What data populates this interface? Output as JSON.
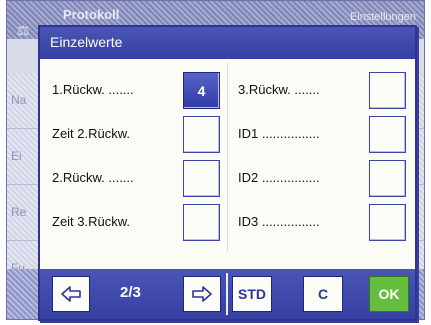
{
  "background": {
    "title": "Protokoll",
    "title_right": "Einstellungen",
    "rows": [
      "Na",
      "Ei",
      "Re",
      "Fu"
    ]
  },
  "dialog": {
    "title": "Einzelwerte",
    "left": [
      {
        "label": "1.Rückw.  .......",
        "value": "4",
        "active": true
      },
      {
        "label": "Zeit 2.Rückw.",
        "value": "",
        "active": false
      },
      {
        "label": "2.Rückw.  .......",
        "value": "",
        "active": false
      },
      {
        "label": "Zeit 3.Rückw.",
        "value": "",
        "active": false
      }
    ],
    "right": [
      {
        "label": "3.Rückw.  .......",
        "value": "",
        "active": false
      },
      {
        "label": "ID1  ................",
        "value": "",
        "active": false
      },
      {
        "label": "ID2  ................",
        "value": "",
        "active": false
      },
      {
        "label": "ID3  ................",
        "value": "",
        "active": false
      }
    ]
  },
  "nav": {
    "page": "2/3",
    "prev_icon": "arrow-left-icon",
    "next_icon": "arrow-right-icon",
    "std_label": "STD",
    "c_label": "C",
    "ok_label": "OK"
  },
  "colors": {
    "accent": "#3540a2",
    "ok": "#64bd3c",
    "active_value": "#2f3aa4"
  }
}
